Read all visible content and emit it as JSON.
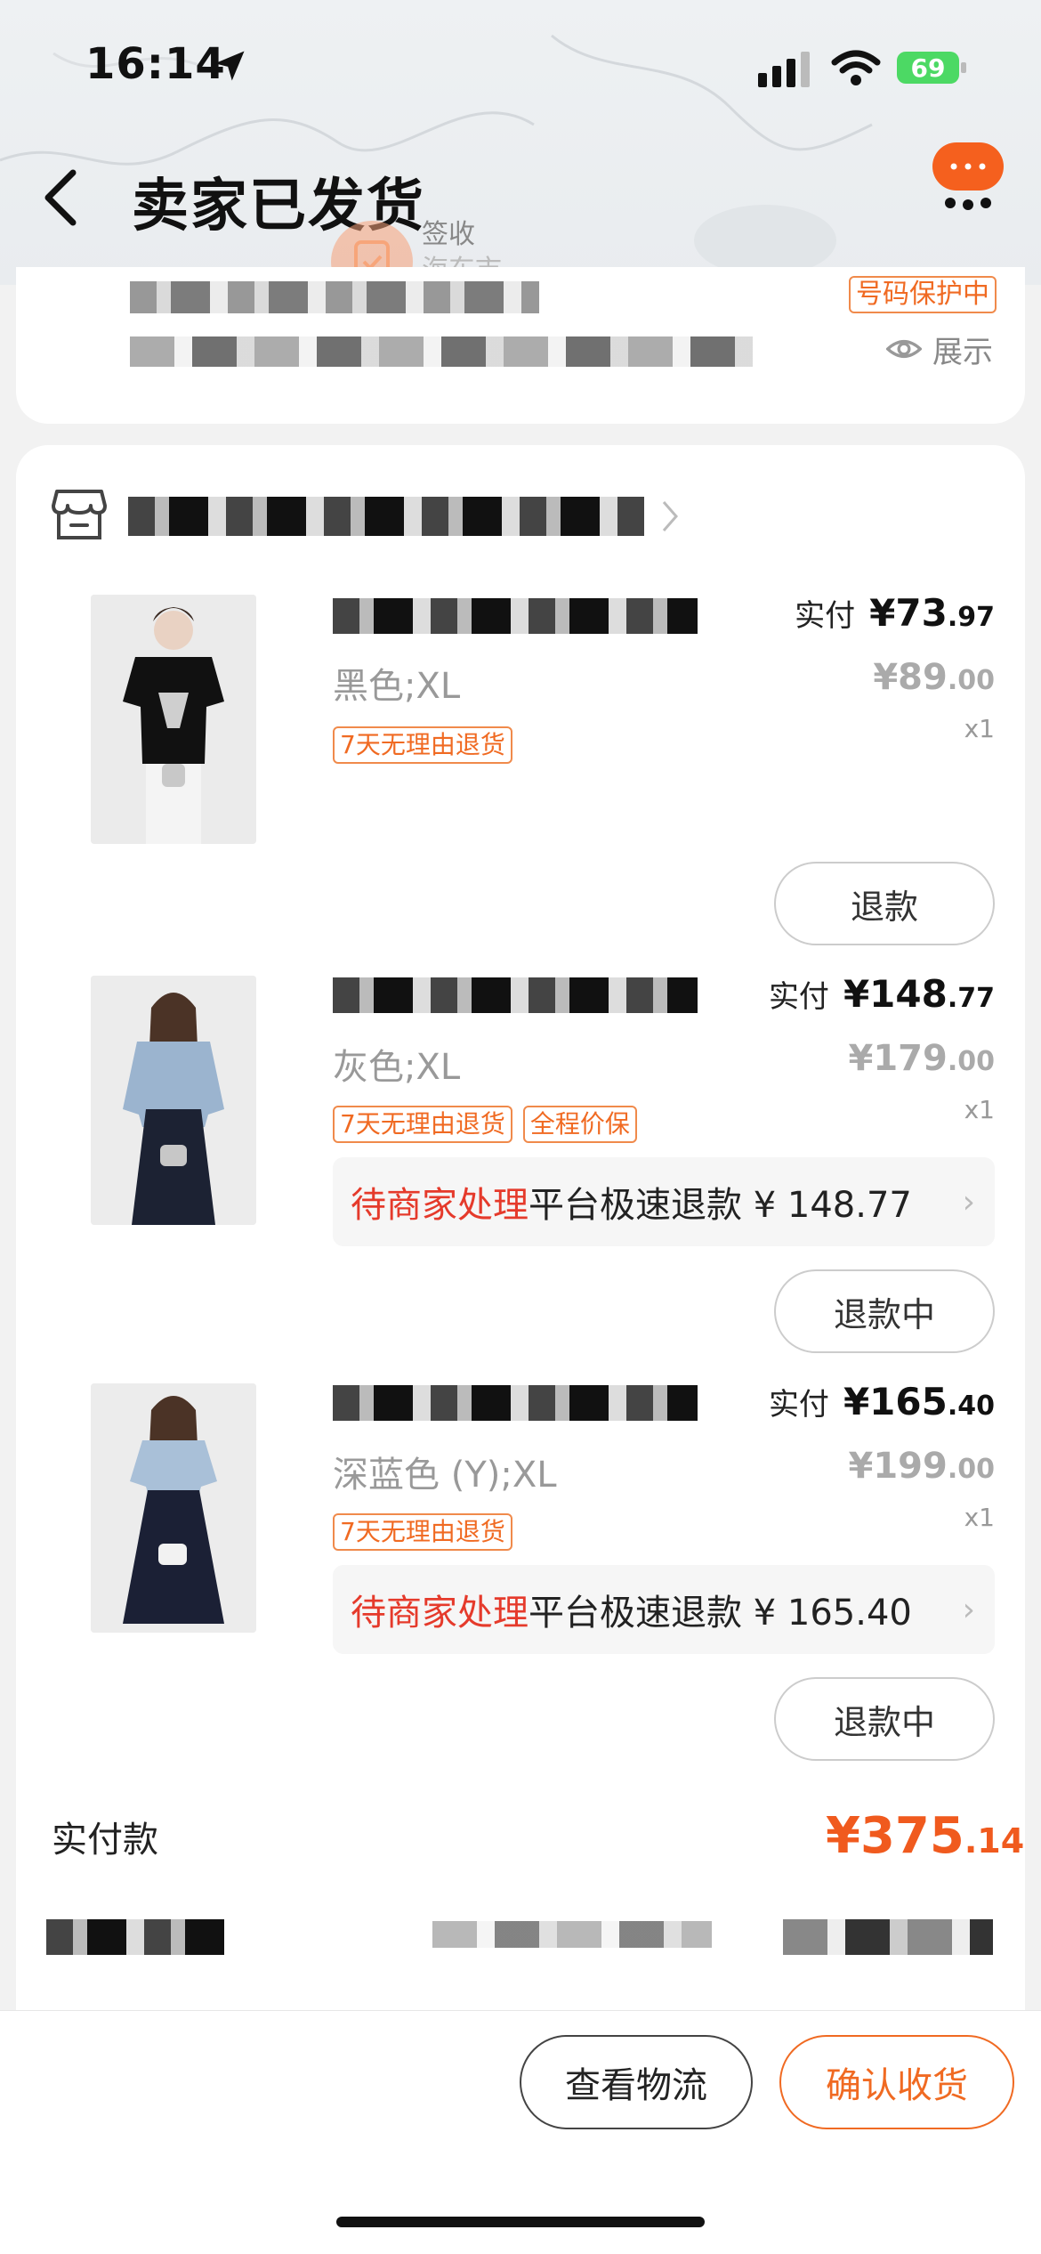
{
  "status_bar": {
    "time": "16:14",
    "battery": "69"
  },
  "nav": {
    "title": "卖家已发货",
    "map_label_line1": "签收",
    "map_label_line2": "海东市"
  },
  "address": {
    "phone_protect_tag": "号码保护中",
    "show_label": "展示"
  },
  "items": [
    {
      "spec": "黑色;XL",
      "tags": [
        "7天无理由退货"
      ],
      "paid_label": "实付",
      "paid_int": "¥73",
      "paid_dec": ".97",
      "orig_int": "¥89",
      "orig_dec": ".00",
      "qty": "x1",
      "button": "退款"
    },
    {
      "spec": "灰色;XL",
      "tags": [
        "7天无理由退货",
        "全程价保"
      ],
      "paid_label": "实付",
      "paid_int": "¥148",
      "paid_dec": ".77",
      "orig_int": "¥179",
      "orig_dec": ".00",
      "qty": "x1",
      "refund_status": "待商家处理",
      "refund_text": "平台极速退款 ¥ 148.77",
      "button": "退款中"
    },
    {
      "spec": "深蓝色 (Y);XL",
      "tags": [
        "7天无理由退货"
      ],
      "paid_label": "实付",
      "paid_int": "¥165",
      "paid_dec": ".40",
      "orig_int": "¥199",
      "orig_dec": ".00",
      "qty": "x1",
      "refund_status": "待商家处理",
      "refund_text": "平台极速退款 ¥ 165.40",
      "button": "退款中"
    }
  ],
  "total": {
    "label": "实付款",
    "int": "¥375",
    "dec": ".14"
  },
  "bottom": {
    "logistics_label": "查看物流",
    "confirm_label": "确认收货"
  },
  "colors": {
    "accent": "#f05a1e",
    "tag_border": "#f08a4b",
    "refund_status_red": "#e53a2b"
  }
}
